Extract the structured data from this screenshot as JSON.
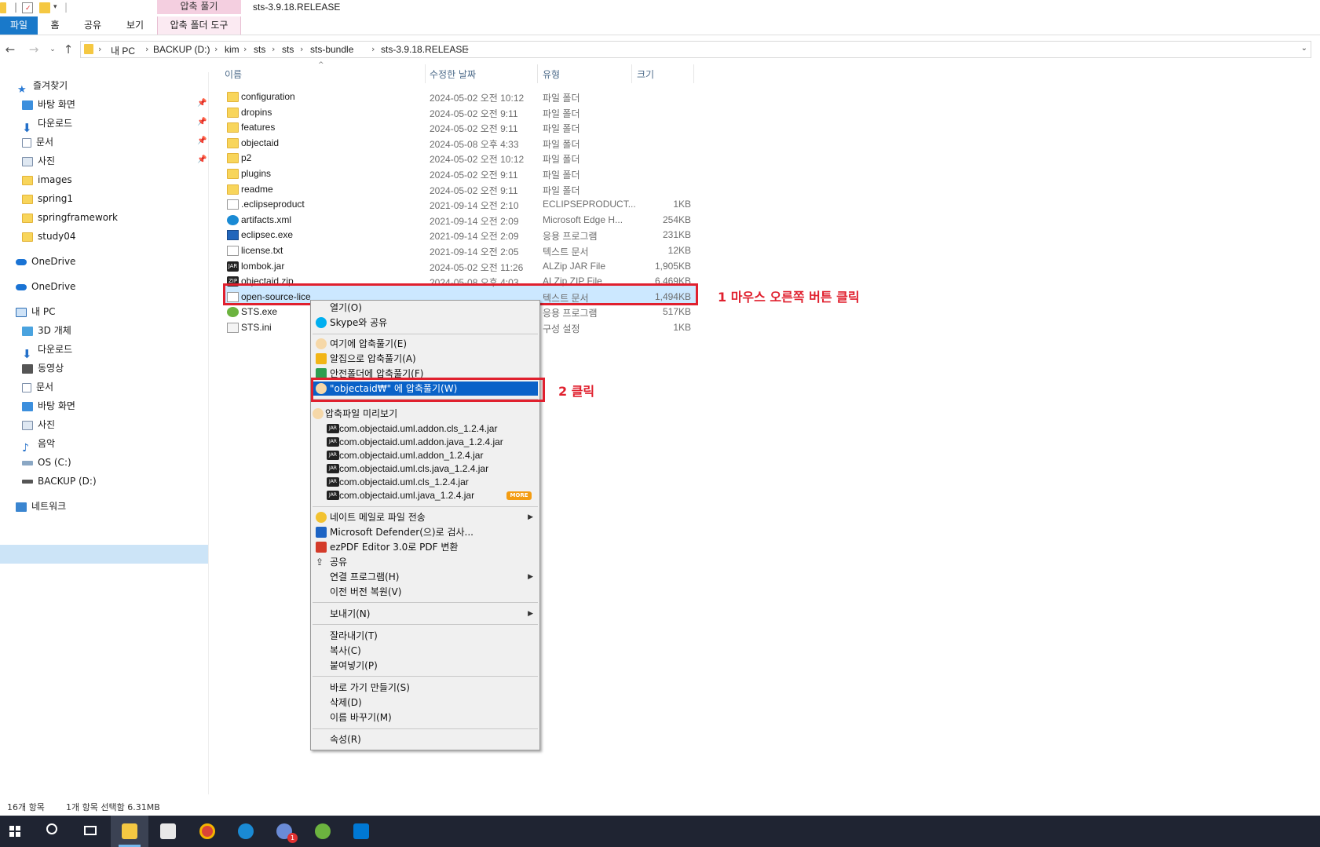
{
  "window": {
    "title": "sts-3.9.18.RELEASE",
    "context_tab_group": "압축 풀기"
  },
  "ribbon": {
    "tabs": [
      "파일",
      "홈",
      "공유",
      "보기",
      "압축 폴더 도구"
    ]
  },
  "address": {
    "crumbs": [
      "내 PC",
      "BACKUP (D:)",
      "kim",
      "sts",
      "sts",
      "sts-bundle",
      "sts-3.9.18.RELEASE"
    ]
  },
  "nav": {
    "quick_access": "즐겨찾기",
    "quick_items": [
      "바탕 화면",
      "다운로드",
      "문서",
      "사진",
      "images",
      "spring1",
      "springframework",
      "study04"
    ],
    "onedrive_1": "OneDrive",
    "onedrive_2": "OneDrive",
    "this_pc": "내 PC",
    "pc_items": [
      "3D 개체",
      "다운로드",
      "동영상",
      "문서",
      "바탕 화면",
      "사진",
      "음악",
      "OS (C:)",
      "BACKUP (D:)"
    ],
    "network": "네트워크"
  },
  "columns": {
    "name": "이름",
    "date": "수정한 날짜",
    "type": "유형",
    "size": "크기"
  },
  "files": [
    {
      "name": "configuration",
      "date": "2024-05-02 오전 10:12",
      "type": "파일 폴더",
      "size": "",
      "icon": "folder-icon"
    },
    {
      "name": "dropins",
      "date": "2024-05-02 오전 9:11",
      "type": "파일 폴더",
      "size": "",
      "icon": "folder-icon"
    },
    {
      "name": "features",
      "date": "2024-05-02 오전 9:11",
      "type": "파일 폴더",
      "size": "",
      "icon": "folder-icon"
    },
    {
      "name": "objectaid",
      "date": "2024-05-08 오후 4:33",
      "type": "파일 폴더",
      "size": "",
      "icon": "folder-icon"
    },
    {
      "name": "p2",
      "date": "2024-05-02 오전 10:12",
      "type": "파일 폴더",
      "size": "",
      "icon": "folder-icon"
    },
    {
      "name": "plugins",
      "date": "2024-05-02 오전 9:11",
      "type": "파일 폴더",
      "size": "",
      "icon": "folder-icon"
    },
    {
      "name": "readme",
      "date": "2024-05-02 오전 9:11",
      "type": "파일 폴더",
      "size": "",
      "icon": "folder-icon"
    },
    {
      "name": ".eclipseproduct",
      "date": "2021-09-14 오전 2:10",
      "type": "ECLIPSEPRODUCT...",
      "size": "1KB",
      "icon": "file-icon"
    },
    {
      "name": "artifacts.xml",
      "date": "2021-09-14 오전 2:09",
      "type": "Microsoft Edge H...",
      "size": "254KB",
      "icon": "edge-icon"
    },
    {
      "name": "eclipsec.exe",
      "date": "2021-09-14 오전 2:09",
      "type": "응용 프로그램",
      "size": "231KB",
      "icon": "exe-icon"
    },
    {
      "name": "license.txt",
      "date": "2021-09-14 오전 2:05",
      "type": "텍스트 문서",
      "size": "12KB",
      "icon": "text-file-icon"
    },
    {
      "name": "lombok.jar",
      "date": "2024-05-02 오전 11:26",
      "type": "ALZip JAR File",
      "size": "1,905KB",
      "icon": "jar-icon"
    },
    {
      "name": "objectaid.zip",
      "date": "2024-05-08 오후 4:03",
      "type": "ALZip ZIP File",
      "size": "6,469KB",
      "icon": "zip-icon"
    },
    {
      "name": "open-source-lice",
      "date": "",
      "type": "텍스트 문서",
      "size": "1,494KB",
      "icon": "text-file-icon"
    },
    {
      "name": "STS.exe",
      "date": "",
      "type": "응용 프로그램",
      "size": "517KB",
      "icon": "sts-icon"
    },
    {
      "name": "STS.ini",
      "date": "",
      "type": "구성 설정",
      "size": "1KB",
      "icon": "ini-icon"
    }
  ],
  "annotations": {
    "step1": "1 마우스 오른쪽 버튼 클릭",
    "step2": "2 클릭"
  },
  "context_menu": {
    "open": "열기(O)",
    "skype": "Skype와 공유",
    "extract_here": "여기에 압축풀기(E)",
    "alzip_extract": "알집으로 압축풀기(A)",
    "safe_extract": "안전폴더에 압축풀기(F)",
    "extract_named": "\"objectaid₩\" 에 압축풀기(W)",
    "preview": "압축파일 미리보기",
    "preview_items": [
      "com.objectaid.uml.addon.cls_1.2.4.jar",
      "com.objectaid.uml.addon.java_1.2.4.jar",
      "com.objectaid.uml.addon_1.2.4.jar",
      "com.objectaid.uml.cls.java_1.2.4.jar",
      "com.objectaid.uml.cls_1.2.4.jar",
      "com.objectaid.uml.java_1.2.4.jar"
    ],
    "more_badge": "MORE",
    "nate_mail": "네이트 메일로 파일 전송",
    "defender": "Microsoft Defender(으)로 검사...",
    "ezpdf": "ezPDF Editor 3.0로 PDF 변환",
    "share": "공유",
    "open_with": "연결 프로그램(H)",
    "restore_prev": "이전 버전 복원(V)",
    "send_to": "보내기(N)",
    "cut": "잘라내기(T)",
    "copy": "복사(C)",
    "paste": "붙여넣기(P)",
    "shortcut": "바로 가기 만들기(S)",
    "delete": "삭제(D)",
    "rename": "이름 바꾸기(M)",
    "properties": "속성(R)"
  },
  "status": {
    "count": "16개 항목",
    "selected": "1개 항목 선택함 6.31MB"
  },
  "taskbar": {
    "badge": "1"
  },
  "colors": {
    "accent": "#1979ca",
    "highlight_red": "#e0202e",
    "selection": "#cce8ff",
    "menu_highlight": "#0a62c8"
  }
}
